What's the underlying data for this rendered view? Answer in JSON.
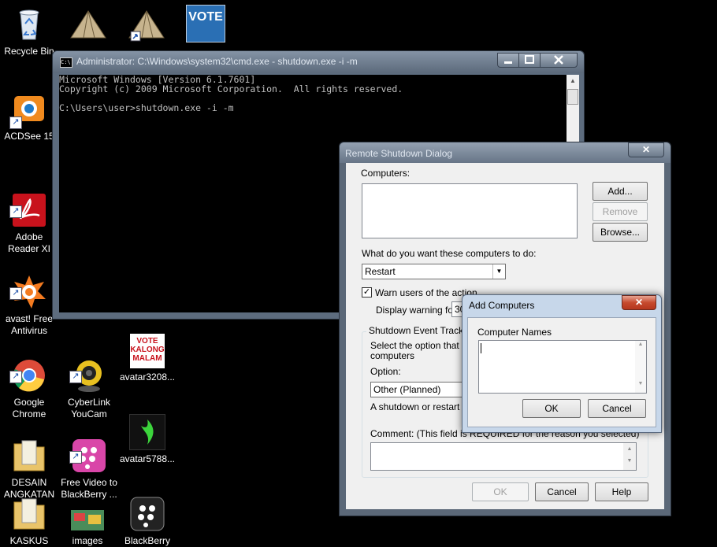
{
  "desktop": {
    "icons": [
      {
        "label": "Recycle Bin"
      },
      {
        "label": "ACDSee 15"
      },
      {
        "label": "Adobe\nReader XI"
      },
      {
        "label": "avast! Free\nAntivirus"
      },
      {
        "label": "Google\nChrome"
      },
      {
        "label": "CyberLink\nYouCam"
      },
      {
        "label": "avatar3208..."
      },
      {
        "label": "DESAIN\nANGKATAN"
      },
      {
        "label": "Free Video to\nBlackBerry ..."
      },
      {
        "label": "avatar5788..."
      },
      {
        "label": "KASKUS"
      },
      {
        "label": "images"
      },
      {
        "label": "BlackBerry"
      }
    ],
    "vote_image_text": "VOTE KALONG MALAM",
    "top_vote_text": "VOTE"
  },
  "cmd": {
    "title": "Administrator: C:\\Windows\\system32\\cmd.exe - shutdown.exe  -i -m",
    "icon_text": "C:\\",
    "output": "Microsoft Windows [Version 6.1.7601]\nCopyright (c) 2009 Microsoft Corporation.  All rights reserved.\n\nC:\\Users\\user>shutdown.exe -i -m"
  },
  "shutdown_dialog": {
    "title": "Remote Shutdown Dialog",
    "computers_label": "Computers:",
    "add_button": "Add...",
    "remove_button": "Remove",
    "browse_button": "Browse...",
    "action_label": "What do you want these computers to do:",
    "action_value": "Restart",
    "warn_label": "Warn users of the action",
    "warn_checked": true,
    "display_warning_label": "Display warning for",
    "display_warning_value": "30",
    "tracker_group_label": "Shutdown Event Tracker",
    "tracker_desc": "Select the option that bes",
    "tracker_desc2": "computers",
    "option_label": "Option:",
    "option_value": "Other (Planned)",
    "restart_desc": "A shutdown or restart for",
    "comment_label": "Comment: (This field is REQUIRED for the reason you selected)",
    "ok_button": "OK",
    "cancel_button": "Cancel",
    "help_button": "Help",
    "close_glyph": "✕"
  },
  "add_computers": {
    "title": "Add Computers",
    "names_label": "Computer Names",
    "ok_button": "OK",
    "cancel_button": "Cancel",
    "close_glyph": "✕"
  }
}
